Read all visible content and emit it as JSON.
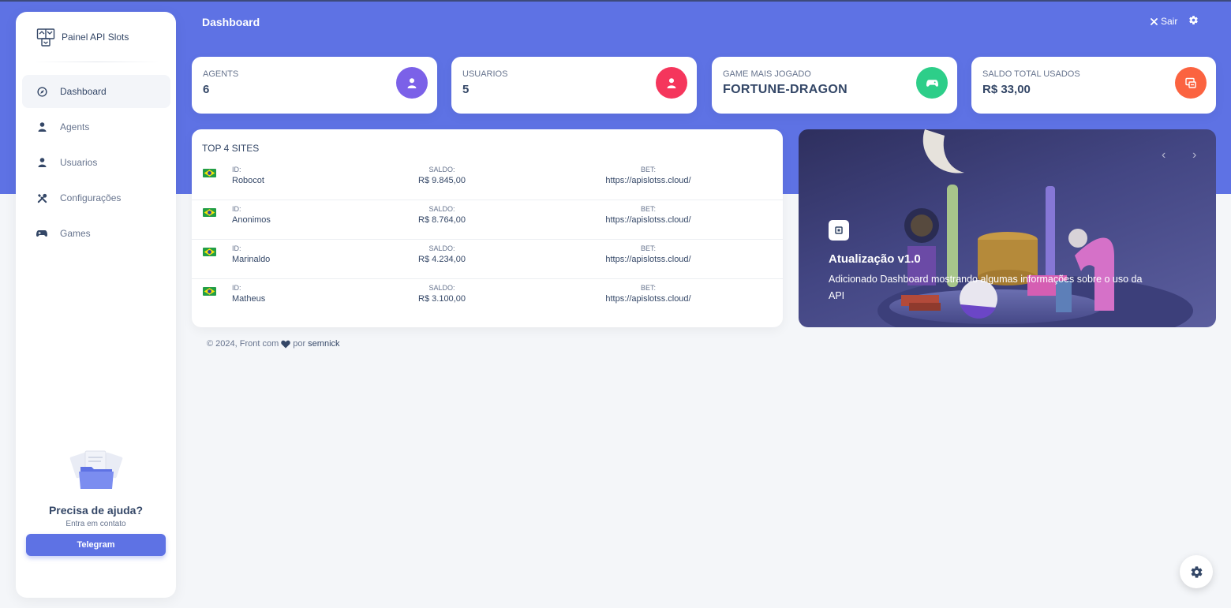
{
  "header": {
    "title": "Dashboard",
    "logout_label": "Sair"
  },
  "sidebar": {
    "brand": "Painel API Slots",
    "items": [
      {
        "label": "Dashboard",
        "icon": "compass-icon",
        "active": true
      },
      {
        "label": "Agents",
        "icon": "user-icon"
      },
      {
        "label": "Usuarios",
        "icon": "user-icon"
      },
      {
        "label": "Configurações",
        "icon": "tools-icon"
      },
      {
        "label": "Games",
        "icon": "gamepad-icon"
      }
    ],
    "help": {
      "title": "Precisa de ajuda?",
      "subtitle": "Entra em contato",
      "button": "Telegram"
    }
  },
  "stats": [
    {
      "label": "AGENTS",
      "value": "6",
      "color": "#7b61e8",
      "icon": "user-icon"
    },
    {
      "label": "USUARIOS",
      "value": "5",
      "color": "#f5365c",
      "icon": "user-icon"
    },
    {
      "label": "GAME MAIS JOGADO",
      "value": "FORTUNE-DRAGON",
      "color": "#2dce89",
      "icon": "gamepad-icon"
    },
    {
      "label": "SALDO TOTAL USADOS",
      "value": "R$ 33,00",
      "color": "#fb6340",
      "icon": "wallet-icon"
    }
  ],
  "top_sites": {
    "title": "TOP 4 SITES",
    "id_label": "ID:",
    "saldo_label": "SALDO:",
    "bet_label": "BET:",
    "rows": [
      {
        "id": "Robocot",
        "saldo": "R$ 9.845,00",
        "bet": "https://apislotss.cloud/"
      },
      {
        "id": "Anonimos",
        "saldo": "R$ 8.764,00",
        "bet": "https://apislotss.cloud/"
      },
      {
        "id": "Marinaldo",
        "saldo": "R$ 4.234,00",
        "bet": "https://apislotss.cloud/"
      },
      {
        "id": "Matheus",
        "saldo": "R$ 3.100,00",
        "bet": "https://apislotss.cloud/"
      }
    ]
  },
  "carousel": {
    "title": "Atualização v1.0",
    "text": "Adicionado Dashboard mostrando algumas informações sobre o uso da API"
  },
  "footer": {
    "prefix": "© 2024, Front com",
    "middle": "por",
    "author": "semnick"
  },
  "colors": {
    "primary": "#5e72e4",
    "text": "#344767",
    "muted": "#67748e"
  }
}
